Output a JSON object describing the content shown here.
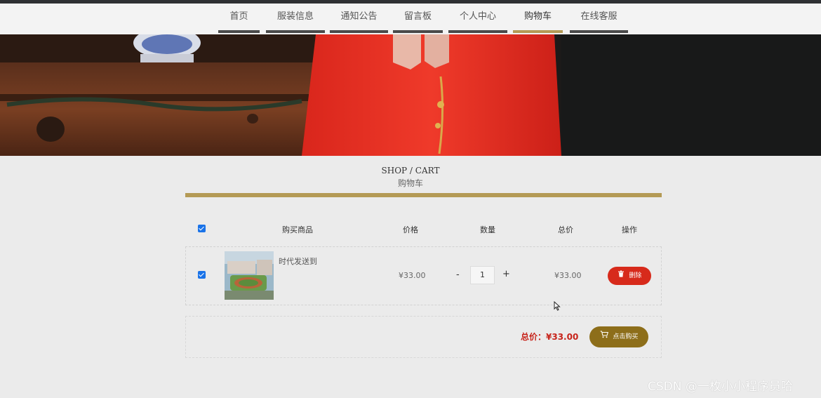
{
  "nav": {
    "items": [
      {
        "label": "首页",
        "active": false
      },
      {
        "label": "服装信息",
        "active": false
      },
      {
        "label": "通知公告",
        "active": false
      },
      {
        "label": "留言板",
        "active": false
      },
      {
        "label": "个人中心",
        "active": false
      },
      {
        "label": "购物车",
        "active": true
      },
      {
        "label": "在线客服",
        "active": false
      }
    ],
    "accent_color": "#b49a55"
  },
  "page": {
    "title_en": "SHOP / CART",
    "title_zh": "购物车"
  },
  "cart": {
    "headers": {
      "product": "购买商品",
      "price": "价格",
      "quantity": "数量",
      "subtotal": "总价",
      "action": "操作"
    },
    "select_all_checked": true,
    "items": [
      {
        "checked": true,
        "name": "时代发送到",
        "price": "¥33.00",
        "quantity": "1",
        "subtotal": "¥33.00",
        "delete_label": "删除",
        "delete_icon": "trash-icon"
      }
    ],
    "qty_minus": "-",
    "qty_plus": "+",
    "total_text": "总价：¥33.00",
    "buy_label": "点击购买",
    "buy_icon": "cart-icon"
  },
  "watermark": "CSDN @一枚小小程序员哈"
}
